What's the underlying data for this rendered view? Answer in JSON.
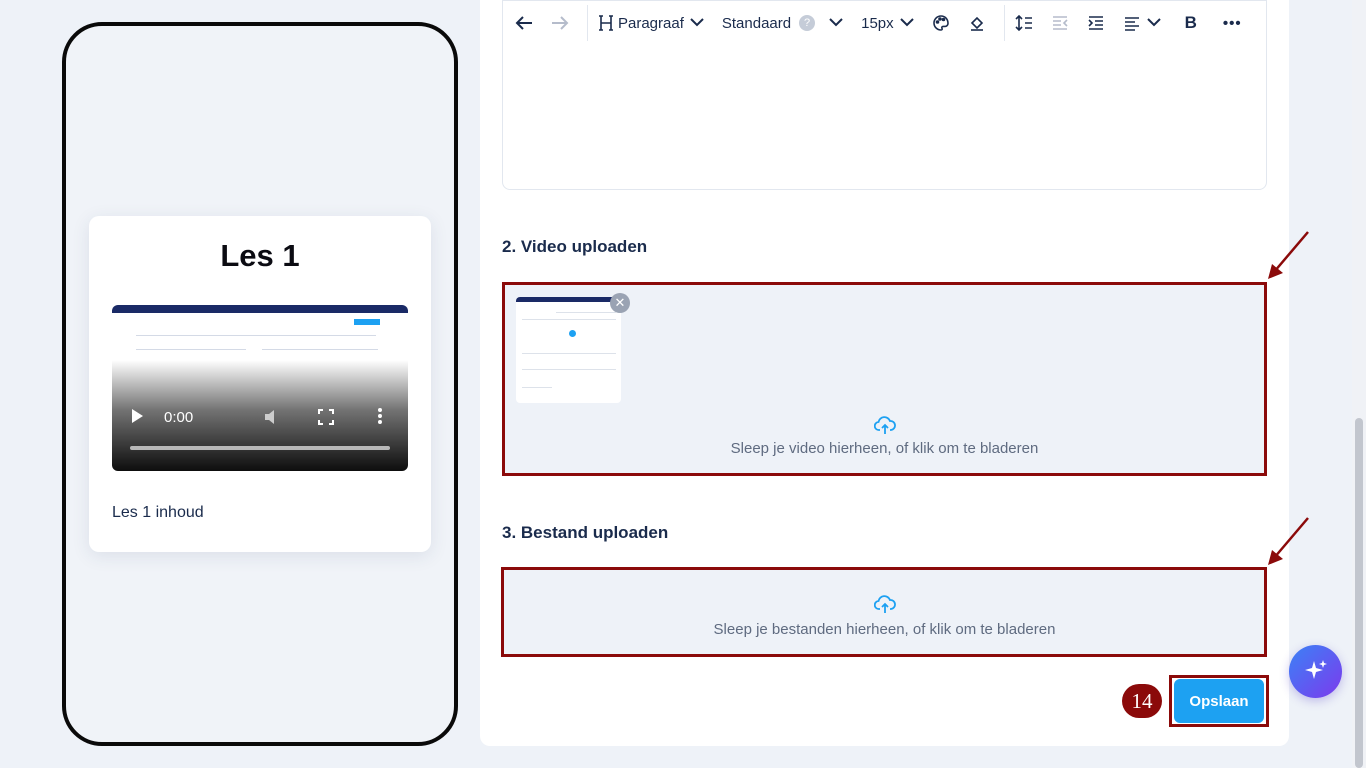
{
  "preview": {
    "lesson_title": "Les 1",
    "video_time": "0:00",
    "lesson_content": "Les 1 inhoud"
  },
  "toolbar": {
    "paragraph": "Paragraaf",
    "font": "Standaard",
    "font_help": "?",
    "size": "15px",
    "bold": "B",
    "more": "•••"
  },
  "sections": {
    "video_title": "2. Video uploaden",
    "video_hint": "Sleep je video hierheen, of klik om te bladeren",
    "file_title": "3. Bestand uploaden",
    "file_hint": "Sleep je bestanden hierheen, of klik om te bladeren"
  },
  "actions": {
    "save_label": "Opslaan",
    "step_number": "14"
  },
  "colors": {
    "accent": "#1da1f2",
    "highlight": "#8b0a0a",
    "heading": "#1a2b4c"
  },
  "icons": [
    "undo-icon",
    "redo-icon",
    "heading-icon",
    "palette-icon",
    "fill-icon",
    "line-height-icon",
    "outdent-icon",
    "indent-icon",
    "align-icon",
    "upload-cloud-icon",
    "close-icon",
    "sparkle-icon"
  ]
}
